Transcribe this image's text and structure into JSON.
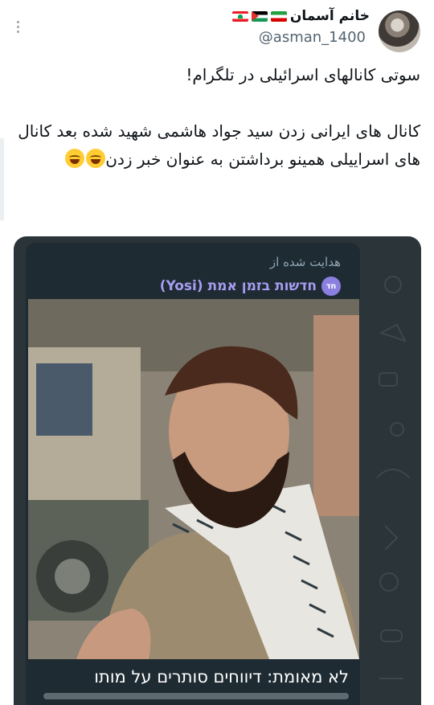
{
  "tweet": {
    "display_name": "خانم آسمان",
    "handle": "@asman_1400",
    "text": "سوتی کانالهای اسرائیلی در تلگرام!\n\nکانال های ایرانی زدن سید جواد هاشمی شهید شده بعد کانال های اسراییلی همینو برداشتن به عنوان خبر زدن",
    "flags": [
      "iran-flag",
      "palestine-flag",
      "lebanon-flag"
    ],
    "emoji": [
      "grinning-sweat-emoji",
      "grinning-sweat-emoji"
    ]
  },
  "telegram_post": {
    "forwarded_label": "هدایت شده از",
    "channel_avatar_text": "חד",
    "channel_name": "חדשות בזמן אמת (Yosi)",
    "caption": "לא מאומת: דיווחים סותרים על מותו"
  },
  "colors": {
    "background": "#ffffff",
    "text": "#0f1419",
    "secondary_text": "#536471",
    "telegram_bg": "#2a3439",
    "bubble_bg": "#1e2b33",
    "channel_name": "#a79df0"
  }
}
